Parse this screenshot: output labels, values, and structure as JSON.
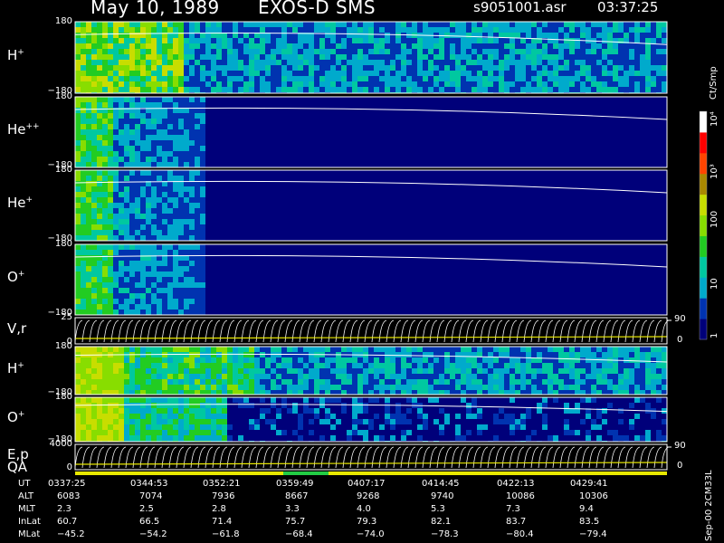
{
  "header": {
    "date": "May 10, 1989",
    "instrument": "EXOS-D SMS",
    "filename": "s9051001.asr",
    "time": "03:37:25"
  },
  "panels": [
    {
      "id": "h-plus-1",
      "ion_base": "H",
      "ion_sup": "+",
      "top_tick": "180",
      "bottom_tick": "−180"
    },
    {
      "id": "he-pp",
      "ion_base": "He",
      "ion_sup": "++",
      "top_tick": "180",
      "bottom_tick": "−180"
    },
    {
      "id": "he-plus",
      "ion_base": "He",
      "ion_sup": "+",
      "top_tick": "180",
      "bottom_tick": "−180"
    },
    {
      "id": "o-plus-1",
      "ion_base": "O",
      "ion_sup": "+",
      "top_tick": "180",
      "bottom_tick": "−180"
    },
    {
      "id": "vr",
      "ion_base": "V,r",
      "ion_sup": "",
      "top_tick": "25",
      "bottom_tick": "0",
      "right_top": "90",
      "right_bottom": "0"
    },
    {
      "id": "h-plus-2",
      "ion_base": "H",
      "ion_sup": "+",
      "top_tick": "180",
      "bottom_tick": "−180"
    },
    {
      "id": "o-plus-2",
      "ion_base": "O",
      "ion_sup": "+",
      "top_tick": "180",
      "bottom_tick": "−180"
    },
    {
      "id": "ep",
      "ion_base": "E,p",
      "ion_sup": "",
      "top_tick": "4000",
      "bottom_tick": "0",
      "right_top": "90",
      "right_bottom": "0",
      "extra_label": "QA"
    }
  ],
  "colorbar": {
    "unit": "Ct/Smp",
    "labels": [
      "10⁴",
      "10³",
      "100",
      "10",
      "1"
    ]
  },
  "footer": {
    "side_label": "Sep-00 2CM33L",
    "rows": [
      {
        "name": "UT",
        "values": [
          "0337:25",
          "0344:53",
          "0352:21",
          "0359:49",
          "0407:17",
          "0414:45",
          "0422:13",
          "0429:41"
        ]
      },
      {
        "name": "ALT",
        "values": [
          "6083",
          "7074",
          "7936",
          "8667",
          "9268",
          "9740",
          "10086",
          "10306"
        ]
      },
      {
        "name": "MLT",
        "values": [
          "2.3",
          "2.5",
          "2.8",
          "3.3",
          "4.0",
          "5.3",
          "7.3",
          "9.4"
        ]
      },
      {
        "name": "InLat",
        "values": [
          "60.7",
          "66.5",
          "71.4",
          "75.7",
          "79.3",
          "82.1",
          "83.7",
          "83.5"
        ]
      },
      {
        "name": "MLat",
        "values": [
          "−45.2",
          "−54.2",
          "−61.8",
          "−68.4",
          "−74.0",
          "−78.3",
          "−80.4",
          "−79.4"
        ]
      }
    ]
  },
  "chart_data": {
    "type": "heatmap",
    "title": "May 10, 1989   EXOS-D SMS",
    "colorscale": [
      "#00007a",
      "#0033b0",
      "#00aacc",
      "#00c8a0",
      "#22cc22",
      "#88dd00",
      "#c8dd00",
      "#aa8800",
      "#ff4400",
      "#ff0000",
      "#ffffff"
    ],
    "panel_types": {
      "h-plus-1": "spectrogram",
      "he-pp": "spectrogram",
      "he-plus": "spectrogram",
      "o-plus-1": "spectrogram",
      "vr": "line",
      "h-plus-2": "spectrogram",
      "o-plus-2": "spectrogram",
      "ep": "line"
    },
    "colorbar_scale": "log",
    "colorbar_range": [
      1,
      10000
    ],
    "ut_ticks": [
      "0337:25",
      "0344:53",
      "0352:21",
      "0359:49",
      "0407:17",
      "0414:45",
      "0422:13",
      "0429:41"
    ]
  }
}
